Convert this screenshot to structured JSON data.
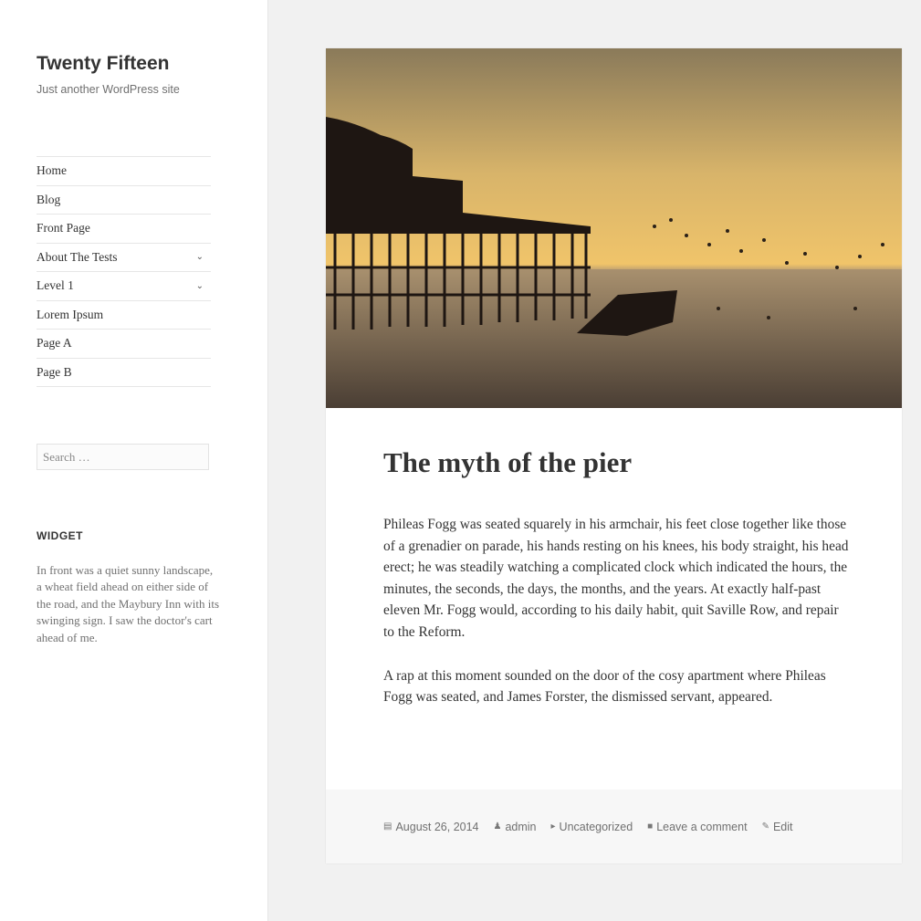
{
  "site": {
    "title": "Twenty Fifteen",
    "description": "Just another WordPress site"
  },
  "nav": {
    "items": [
      {
        "label": "Home"
      },
      {
        "label": "Blog"
      },
      {
        "label": "Front Page"
      },
      {
        "label": "About The Tests",
        "has_submenu": true
      },
      {
        "label": "Level 1",
        "has_submenu": true
      },
      {
        "label": "Lorem Ipsum"
      },
      {
        "label": "Page A"
      },
      {
        "label": "Page B"
      }
    ],
    "submenu_icon": "chevron-down-icon"
  },
  "search": {
    "placeholder": "Search …"
  },
  "widget": {
    "title": "WIDGET",
    "text": "In front was a quiet sunny landscape, a wheat field ahead on either side of the road, and the Maybury Inn with its swinging sign. I saw the doctor's cart ahead of me."
  },
  "post": {
    "title": "The myth of the pier",
    "paragraphs": [
      "Phileas Fogg was seated squarely in his armchair, his feet close together like those of a grenadier on parade, his hands resting on his knees, his body straight, his head erect; he was steadily watching a complicated clock which indicated the hours, the minutes, the seconds, the days, the months, and the years. At exactly half-past eleven Mr. Fogg would, according to his daily habit, quit Saville Row, and repair to the Reform.",
      "A rap at this moment sounded on the door of the cosy apartment where Phileas Fogg was seated, and James Forster, the dismissed servant, appeared."
    ],
    "meta": {
      "date": "August 26, 2014",
      "author": "admin",
      "category": "Uncategorized",
      "comments": "Leave a comment",
      "edit": "Edit"
    }
  },
  "colors": {
    "sidebar_bg": "#ffffff",
    "page_bg": "#f1f1f1",
    "footer_bg": "#f7f7f7",
    "text": "#333333",
    "muted": "#707070"
  }
}
